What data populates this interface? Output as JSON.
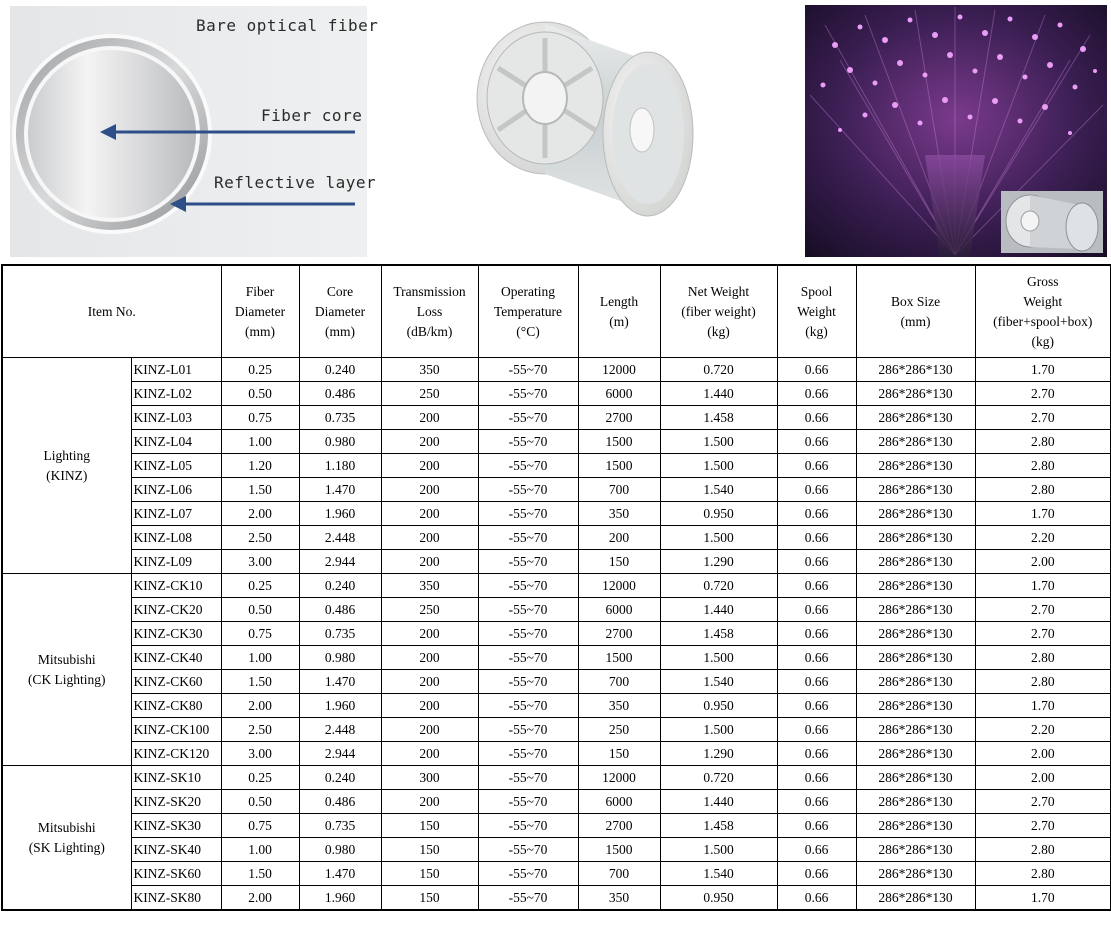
{
  "diagram": {
    "labels": {
      "bare": "Bare optical fiber",
      "core": "Fiber core",
      "reflective": "Reflective layer"
    },
    "arrow_color": "#2d4e86"
  },
  "spool_image": {
    "icon": "fiber-spool-photo"
  },
  "glow_image": {
    "icon": "fiber-optic-light-photo",
    "accent": "#c45ad8"
  },
  "table": {
    "headers": [
      {
        "key": "item",
        "lines": [
          "Item No."
        ]
      },
      {
        "key": "fiber_d",
        "lines": [
          "Fiber",
          "Diameter",
          "(mm)"
        ]
      },
      {
        "key": "core_d",
        "lines": [
          "Core",
          "Diameter",
          "(mm)"
        ]
      },
      {
        "key": "loss",
        "lines": [
          "Transmission",
          "Loss",
          "(dB/km)"
        ]
      },
      {
        "key": "temp",
        "lines": [
          "Operating",
          "Temperature",
          "(°C)"
        ]
      },
      {
        "key": "length",
        "lines": [
          "Length",
          "(m)"
        ]
      },
      {
        "key": "net",
        "lines": [
          "Net Weight",
          "(fiber weight)",
          "(kg)"
        ]
      },
      {
        "key": "spool",
        "lines": [
          "Spool",
          "Weight",
          "(kg)"
        ]
      },
      {
        "key": "box",
        "lines": [
          "Box Size",
          "(mm)"
        ]
      },
      {
        "key": "gross",
        "lines": [
          "Gross",
          "Weight",
          "(fiber+spool+box)",
          "(kg)"
        ]
      }
    ],
    "groups": [
      {
        "label_lines": [
          "Lighting",
          "(KINZ)"
        ],
        "rows": [
          [
            "KINZ-L01",
            "0.25",
            "0.240",
            "350",
            "-55~70",
            "12000",
            "0.720",
            "0.66",
            "286*286*130",
            "1.70"
          ],
          [
            "KINZ-L02",
            "0.50",
            "0.486",
            "250",
            "-55~70",
            "6000",
            "1.440",
            "0.66",
            "286*286*130",
            "2.70"
          ],
          [
            "KINZ-L03",
            "0.75",
            "0.735",
            "200",
            "-55~70",
            "2700",
            "1.458",
            "0.66",
            "286*286*130",
            "2.70"
          ],
          [
            "KINZ-L04",
            "1.00",
            "0.980",
            "200",
            "-55~70",
            "1500",
            "1.500",
            "0.66",
            "286*286*130",
            "2.80"
          ],
          [
            "KINZ-L05",
            "1.20",
            "1.180",
            "200",
            "-55~70",
            "1500",
            "1.500",
            "0.66",
            "286*286*130",
            "2.80"
          ],
          [
            "KINZ-L06",
            "1.50",
            "1.470",
            "200",
            "-55~70",
            "700",
            "1.540",
            "0.66",
            "286*286*130",
            "2.80"
          ],
          [
            "KINZ-L07",
            "2.00",
            "1.960",
            "200",
            "-55~70",
            "350",
            "0.950",
            "0.66",
            "286*286*130",
            "1.70"
          ],
          [
            "KINZ-L08",
            "2.50",
            "2.448",
            "200",
            "-55~70",
            "200",
            "1.500",
            "0.66",
            "286*286*130",
            "2.20"
          ],
          [
            "KINZ-L09",
            "3.00",
            "2.944",
            "200",
            "-55~70",
            "150",
            "1.290",
            "0.66",
            "286*286*130",
            "2.00"
          ]
        ]
      },
      {
        "label_lines": [
          "Mitsubishi",
          "(CK Lighting)"
        ],
        "rows": [
          [
            "KINZ-CK10",
            "0.25",
            "0.240",
            "350",
            "-55~70",
            "12000",
            "0.720",
            "0.66",
            "286*286*130",
            "1.70"
          ],
          [
            "KINZ-CK20",
            "0.50",
            "0.486",
            "250",
            "-55~70",
            "6000",
            "1.440",
            "0.66",
            "286*286*130",
            "2.70"
          ],
          [
            "KINZ-CK30",
            "0.75",
            "0.735",
            "200",
            "-55~70",
            "2700",
            "1.458",
            "0.66",
            "286*286*130",
            "2.70"
          ],
          [
            "KINZ-CK40",
            "1.00",
            "0.980",
            "200",
            "-55~70",
            "1500",
            "1.500",
            "0.66",
            "286*286*130",
            "2.80"
          ],
          [
            "KINZ-CK60",
            "1.50",
            "1.470",
            "200",
            "-55~70",
            "700",
            "1.540",
            "0.66",
            "286*286*130",
            "2.80"
          ],
          [
            "KINZ-CK80",
            "2.00",
            "1.960",
            "200",
            "-55~70",
            "350",
            "0.950",
            "0.66",
            "286*286*130",
            "1.70"
          ],
          [
            "KINZ-CK100",
            "2.50",
            "2.448",
            "200",
            "-55~70",
            "250",
            "1.500",
            "0.66",
            "286*286*130",
            "2.20"
          ],
          [
            "KINZ-CK120",
            "3.00",
            "2.944",
            "200",
            "-55~70",
            "150",
            "1.290",
            "0.66",
            "286*286*130",
            "2.00"
          ]
        ]
      },
      {
        "label_lines": [
          "Mitsubishi",
          "(SK Lighting)"
        ],
        "rows": [
          [
            "KINZ-SK10",
            "0.25",
            "0.240",
            "300",
            "-55~70",
            "12000",
            "0.720",
            "0.66",
            "286*286*130",
            "2.00"
          ],
          [
            "KINZ-SK20",
            "0.50",
            "0.486",
            "200",
            "-55~70",
            "6000",
            "1.440",
            "0.66",
            "286*286*130",
            "2.70"
          ],
          [
            "KINZ-SK30",
            "0.75",
            "0.735",
            "150",
            "-55~70",
            "2700",
            "1.458",
            "0.66",
            "286*286*130",
            "2.70"
          ],
          [
            "KINZ-SK40",
            "1.00",
            "0.980",
            "150",
            "-55~70",
            "1500",
            "1.500",
            "0.66",
            "286*286*130",
            "2.80"
          ],
          [
            "KINZ-SK60",
            "1.50",
            "1.470",
            "150",
            "-55~70",
            "700",
            "1.540",
            "0.66",
            "286*286*130",
            "2.80"
          ],
          [
            "KINZ-SK80",
            "2.00",
            "1.960",
            "150",
            "-55~70",
            "350",
            "0.950",
            "0.66",
            "286*286*130",
            "1.70"
          ]
        ]
      }
    ]
  }
}
